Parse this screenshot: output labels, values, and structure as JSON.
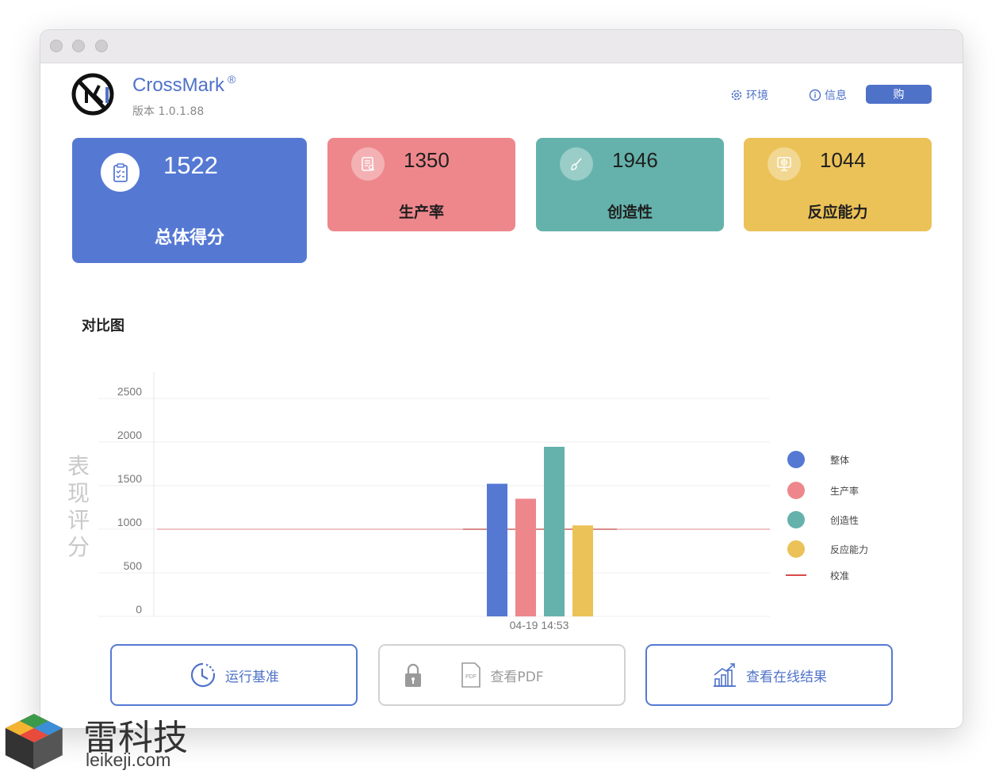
{
  "app": {
    "name": "CrossMark",
    "registered": "®",
    "version": "版本 1.0.1.88"
  },
  "header": {
    "env_label": "环境",
    "info_label": "信息",
    "buy_label": "购"
  },
  "scores": {
    "total": {
      "value": "1522",
      "label": "总体得分"
    },
    "productivity": {
      "value": "1350",
      "label": "生产率"
    },
    "creativity": {
      "value": "1946",
      "label": "创造性"
    },
    "responsiveness": {
      "value": "1044",
      "label": "反应能力"
    }
  },
  "section_title": "对比图",
  "chart_data": {
    "type": "bar",
    "ylabel": "表现评分",
    "ylim": [
      0,
      2500
    ],
    "yticks": [
      0,
      500,
      1000,
      1500,
      2000,
      2500
    ],
    "categories": [
      "04-19 14:53"
    ],
    "series": [
      {
        "name": "整体",
        "values": [
          1522
        ],
        "color": "#5579d3"
      },
      {
        "name": "生产率",
        "values": [
          1350
        ],
        "color": "#ee878c"
      },
      {
        "name": "创造性",
        "values": [
          1946
        ],
        "color": "#64b2ab"
      },
      {
        "name": "反应能力",
        "values": [
          1044
        ],
        "color": "#ebc258"
      }
    ],
    "reference": {
      "name": "校准",
      "value": 1000,
      "color": "#d94a4a"
    },
    "legend": "right",
    "grid": true
  },
  "buttons": {
    "run_label": "运行基准",
    "pdf_label": "查看PDF",
    "pdf_badge": "PDF",
    "online_label": "查看在线结果"
  },
  "watermark": {
    "cn": "雷科技",
    "en": "leikeji.com"
  }
}
